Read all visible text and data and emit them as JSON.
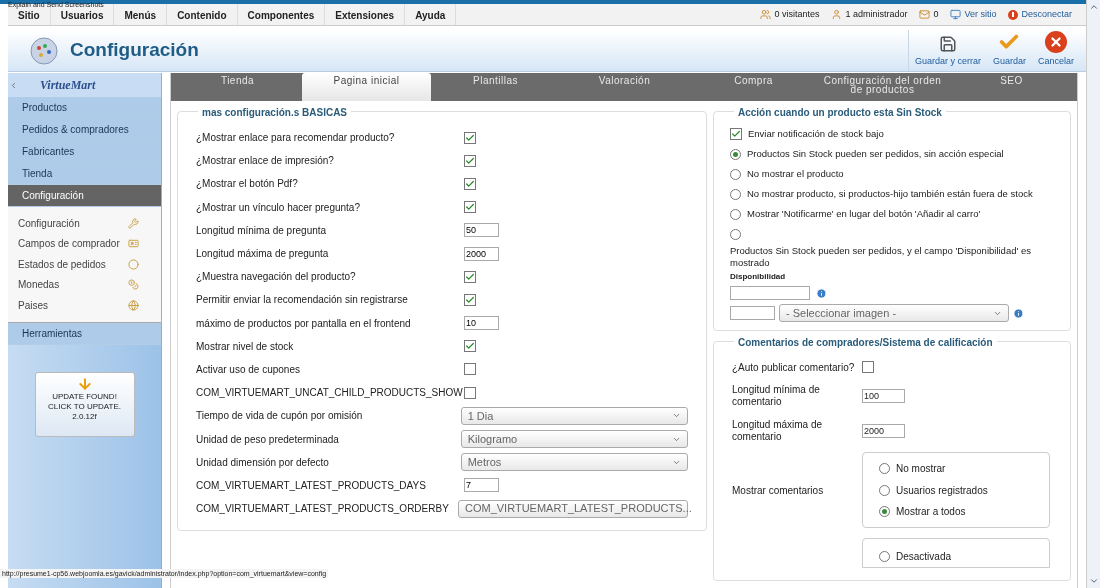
{
  "overlay_label": "Explain and Send Screenshots",
  "top_menu": [
    "Sitio",
    "Usuarios",
    "Menús",
    "Contenido",
    "Componentes",
    "Extensiones",
    "Ayuda"
  ],
  "status_items": [
    {
      "kind": "visitors",
      "text": "0 visitantes"
    },
    {
      "kind": "admins",
      "text": "1 administrador"
    },
    {
      "kind": "messages",
      "text": "0"
    },
    {
      "kind": "site",
      "text": "Ver sitio"
    },
    {
      "kind": "logout",
      "text": "Desconectar"
    }
  ],
  "header": {
    "title": "Configuración",
    "toolbar": [
      {
        "kind": "save_close",
        "label": "Guardar y cerrar"
      },
      {
        "kind": "save",
        "label": "Guardar"
      },
      {
        "kind": "cancel",
        "label": "Cancelar"
      }
    ]
  },
  "sidebar": {
    "logo": "VirtueMart",
    "items": [
      {
        "label": "Productos",
        "selected": false
      },
      {
        "label": "Pedidos & compradores",
        "selected": false
      },
      {
        "label": "Fabricantes",
        "selected": false
      },
      {
        "label": "Tienda",
        "selected": false
      },
      {
        "label": "Configuración",
        "selected": true,
        "children": [
          {
            "label": "Configuración",
            "kind": "tools"
          },
          {
            "label": "Campos de comprador",
            "kind": "user"
          },
          {
            "label": "Estados de pedidos",
            "kind": "status"
          },
          {
            "label": "Monedas",
            "kind": "coins"
          },
          {
            "label": "Paises",
            "kind": "globe"
          }
        ]
      },
      {
        "label": "Herramientas",
        "selected": false
      }
    ],
    "update": "UPDATE FOUND! CLICK TO UPDATE. 2.0.12f"
  },
  "tabs": [
    {
      "label": "Tienda",
      "selected": false
    },
    {
      "label": "Pagina inicial",
      "selected": true
    },
    {
      "label": "Plantillas",
      "selected": false
    },
    {
      "label": "Valoración",
      "selected": false
    },
    {
      "label": "Compra",
      "selected": false
    },
    {
      "label": "Configuración del orden de productos",
      "selected": false
    },
    {
      "label": "SEO",
      "selected": false
    }
  ],
  "basic": {
    "title": "mas configuración.s BASICAS",
    "rows": [
      {
        "kind": "checkbox",
        "label": "¿Mostrar enlace para recomendar producto?",
        "checked": true
      },
      {
        "kind": "checkbox",
        "label": "¿Mostrar enlace de impresión?",
        "checked": true
      },
      {
        "kind": "checkbox",
        "label": "¿Mostrar el botón Pdf?",
        "checked": true
      },
      {
        "kind": "checkbox",
        "label": "¿Mostrar un vínculo hacer pregunta?",
        "checked": true
      },
      {
        "kind": "text",
        "label": "Longitud mínima de pregunta",
        "value": "50"
      },
      {
        "kind": "text",
        "label": "Longitud máxima de pregunta",
        "value": "2000"
      },
      {
        "kind": "checkbox",
        "label": "¿Muestra navegación del producto?",
        "checked": true
      },
      {
        "kind": "checkbox",
        "label": "Permitir enviar la recomendación sin registrarse",
        "checked": true
      },
      {
        "kind": "text",
        "label": "máximo de productos por pantalla en el frontend",
        "value": "10"
      },
      {
        "kind": "checkbox",
        "label": "Mostrar nivel de stock",
        "checked": true
      },
      {
        "kind": "checkbox",
        "label": "Activar uso de cupones",
        "checked": false
      },
      {
        "kind": "checkbox",
        "label": "COM_VIRTUEMART_UNCAT_CHILD_PRODUCTS_SHOW",
        "checked": false
      },
      {
        "kind": "select",
        "label": "Tiempo de vida de cupón por omisión",
        "value": "1 Dia"
      },
      {
        "kind": "select",
        "label": "Unidad de peso predeterminada",
        "value": "Kilogramo"
      },
      {
        "kind": "select",
        "label": "Unidad dimensión por defecto",
        "value": "Metros"
      },
      {
        "kind": "text",
        "label": "COM_VIRTUEMART_LATEST_PRODUCTS_DAYS",
        "value": "7"
      },
      {
        "kind": "select",
        "label": "COM_VIRTUEMART_LATEST_PRODUCTS_ORDERBY",
        "value": "COM_VIRTUEMART_LATEST_PRODUCTS..."
      }
    ]
  },
  "stock": {
    "title": "Acción cuando un producto esta Sin Stock",
    "notify": {
      "label": "Enviar notificación de stock bajo",
      "checked": true
    },
    "options": [
      {
        "label": "Productos Sin Stock pueden ser pedidos, sin acción especial",
        "selected": true
      },
      {
        "label": "No mostrar el producto",
        "selected": false
      },
      {
        "label": "No mostrar producto, si productos-hijo también están fuera de stock",
        "selected": false
      },
      {
        "label": "Mostrar 'Notificarme' en lugar del botón 'Añadir al carro'",
        "selected": false
      },
      {
        "selected": false
      }
    ],
    "note": "Productos Sin Stock pueden ser pedidos, y el campo 'Disponibilidad' es mostrado",
    "availability_label": "Disponibilidad",
    "image_select": "- Seleccionar imagen -"
  },
  "comments": {
    "title": "Comentarios de compradores/Sistema de calificación",
    "auto_publish": {
      "label": "¿Auto publicar comentario?",
      "checked": false
    },
    "min": {
      "label": "Longitud mínima de comentario",
      "value": "100"
    },
    "max": {
      "label": "Longitud máxima de comentario",
      "value": "2000"
    },
    "show": {
      "label": "Mostrar comentarios",
      "options": [
        {
          "label": "No mostrar",
          "selected": false
        },
        {
          "label": "Usuarios registrados",
          "selected": false
        },
        {
          "label": "Mostrar a todos",
          "selected": true
        }
      ]
    },
    "next_options": [
      {
        "label": "Desactivada",
        "selected": false
      }
    ]
  },
  "status_url": "http://presume1-cp56.webjoomla.es/gavick/administrator/index.php?option=com_virtuemart&view=config"
}
